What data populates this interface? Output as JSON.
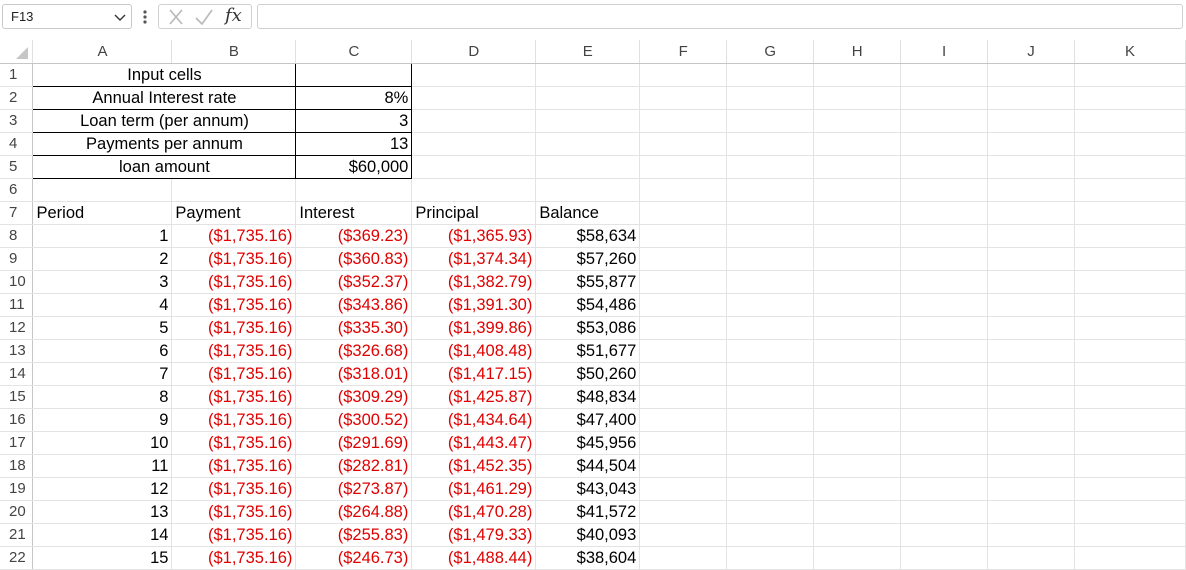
{
  "formula_bar": {
    "name_box": "F13",
    "fx_label": "fx",
    "formula": ""
  },
  "columns": [
    "A",
    "B",
    "C",
    "D",
    "E",
    "F",
    "G",
    "H",
    "I",
    "J",
    "K"
  ],
  "rows": [
    {
      "n": "1",
      "cells": [
        "Input cells",
        "",
        ""
      ]
    },
    {
      "n": "2",
      "cells": [
        "Annual Interest rate",
        "8%",
        ""
      ]
    },
    {
      "n": "3",
      "cells": [
        "Loan term (per annum)",
        "3",
        ""
      ]
    },
    {
      "n": "4",
      "cells": [
        "Payments per annum",
        "13",
        ""
      ]
    },
    {
      "n": "5",
      "cells": [
        "loan amount",
        "$60,000",
        ""
      ]
    },
    {
      "n": "6",
      "cells": []
    },
    {
      "n": "7",
      "cells": [
        "Period",
        "Payment",
        "Interest",
        "Principal",
        "Balance"
      ]
    },
    {
      "n": "8",
      "cells": [
        "1",
        "($1,735.16)",
        "($369.23)",
        "($1,365.93)",
        "$58,634"
      ]
    },
    {
      "n": "9",
      "cells": [
        "2",
        "($1,735.16)",
        "($360.83)",
        "($1,374.34)",
        "$57,260"
      ]
    },
    {
      "n": "10",
      "cells": [
        "3",
        "($1,735.16)",
        "($352.37)",
        "($1,382.79)",
        "$55,877"
      ]
    },
    {
      "n": "11",
      "cells": [
        "4",
        "($1,735.16)",
        "($343.86)",
        "($1,391.30)",
        "$54,486"
      ]
    },
    {
      "n": "12",
      "cells": [
        "5",
        "($1,735.16)",
        "($335.30)",
        "($1,399.86)",
        "$53,086"
      ]
    },
    {
      "n": "13",
      "cells": [
        "6",
        "($1,735.16)",
        "($326.68)",
        "($1,408.48)",
        "$51,677"
      ]
    },
    {
      "n": "14",
      "cells": [
        "7",
        "($1,735.16)",
        "($318.01)",
        "($1,417.15)",
        "$50,260"
      ]
    },
    {
      "n": "15",
      "cells": [
        "8",
        "($1,735.16)",
        "($309.29)",
        "($1,425.87)",
        "$48,834"
      ]
    },
    {
      "n": "16",
      "cells": [
        "9",
        "($1,735.16)",
        "($300.52)",
        "($1,434.64)",
        "$47,400"
      ]
    },
    {
      "n": "17",
      "cells": [
        "10",
        "($1,735.16)",
        "($291.69)",
        "($1,443.47)",
        "$45,956"
      ]
    },
    {
      "n": "18",
      "cells": [
        "11",
        "($1,735.16)",
        "($282.81)",
        "($1,452.35)",
        "$44,504"
      ]
    },
    {
      "n": "19",
      "cells": [
        "12",
        "($1,735.16)",
        "($273.87)",
        "($1,461.29)",
        "$43,043"
      ]
    },
    {
      "n": "20",
      "cells": [
        "13",
        "($1,735.16)",
        "($264.88)",
        "($1,470.28)",
        "$41,572"
      ]
    },
    {
      "n": "21",
      "cells": [
        "14",
        "($1,735.16)",
        "($255.83)",
        "($1,479.33)",
        "$40,093"
      ]
    },
    {
      "n": "22",
      "cells": [
        "15",
        "($1,735.16)",
        "($246.73)",
        "($1,488.44)",
        "$38,604"
      ]
    }
  ],
  "colors": {
    "negative": "#e00000",
    "header_text": "#444444"
  }
}
